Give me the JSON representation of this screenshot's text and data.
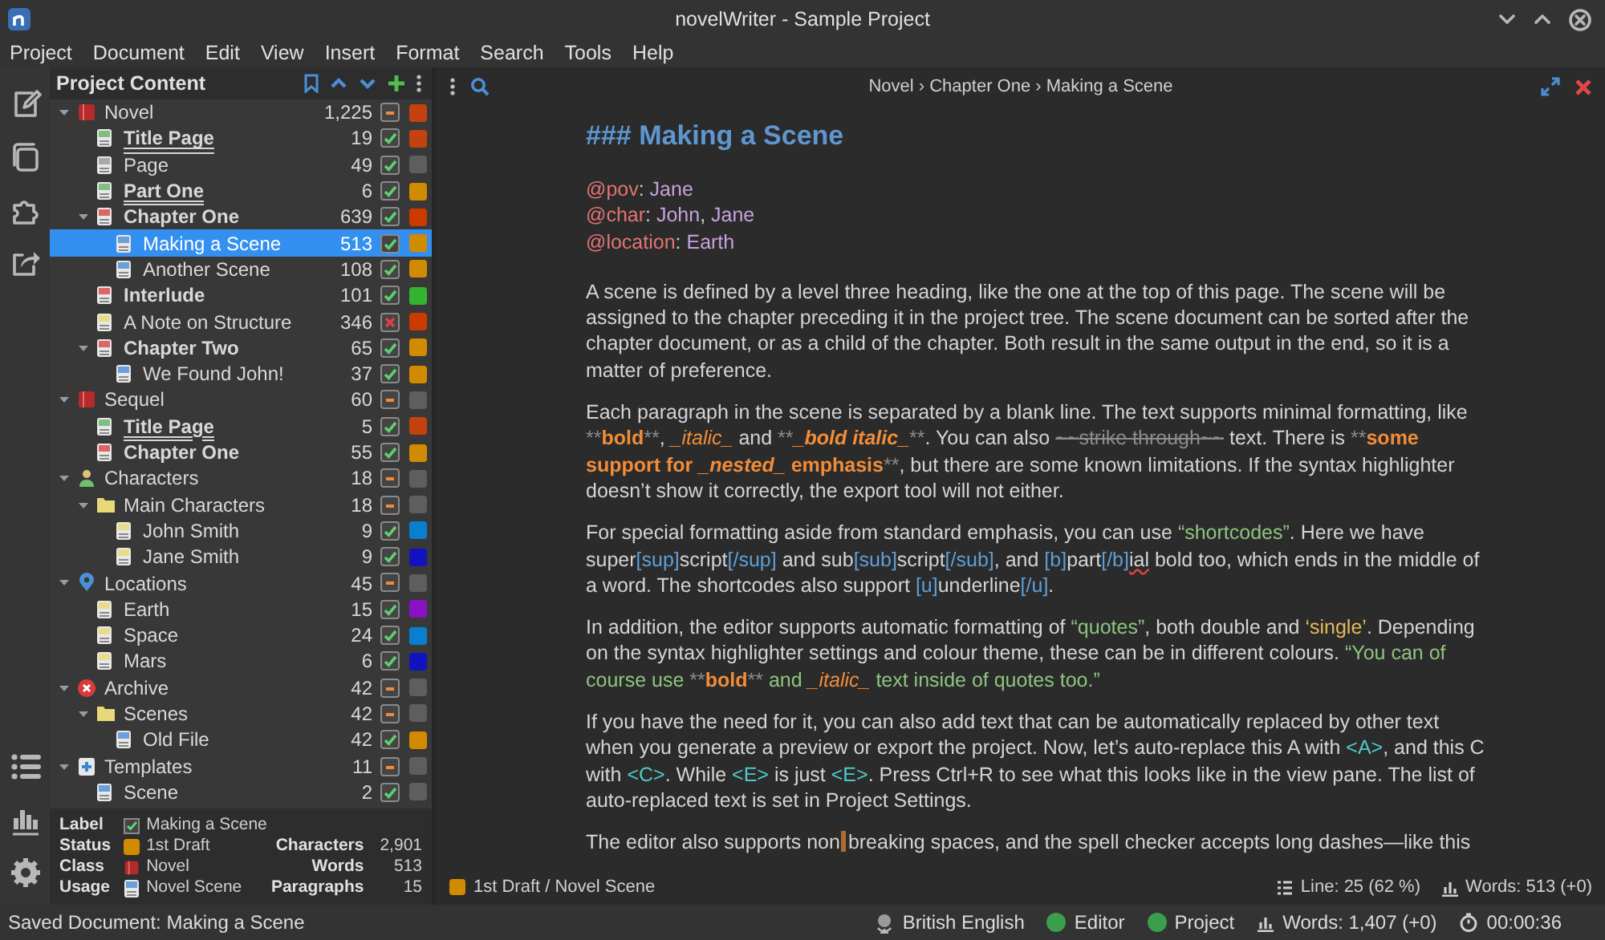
{
  "window": {
    "title": "novelWriter - Sample Project"
  },
  "menu": [
    "Project",
    "Document",
    "Edit",
    "View",
    "Insert",
    "Format",
    "Search",
    "Tools",
    "Help"
  ],
  "project_tree": {
    "title": "Project Content",
    "items": [
      {
        "label": "Novel",
        "kind": "novel",
        "words": "1,225",
        "color": "#c4420f",
        "selected": false,
        "expanded": true,
        "children": [
          {
            "label": "Title Page",
            "kind": "title",
            "words": "19",
            "active": true,
            "color": "#c4420f",
            "selected": false
          },
          {
            "label": "Page",
            "kind": "page",
            "words": "49",
            "active": true,
            "color": "#5e5e5e",
            "selected": false
          },
          {
            "label": "Part One",
            "kind": "partition",
            "words": "6",
            "active": true,
            "color": "#d18b00",
            "selected": false
          },
          {
            "label": "Chapter One",
            "kind": "chapter",
            "words": "639",
            "active": true,
            "color": "#cc3a00",
            "selected": false,
            "expanded": true,
            "children": [
              {
                "label": "Making a Scene",
                "kind": "scene",
                "words": "513",
                "active": true,
                "color": "#d18b00",
                "selected": true
              },
              {
                "label": "Another Scene",
                "kind": "scene",
                "words": "108",
                "active": true,
                "color": "#d18b00",
                "selected": false
              }
            ]
          },
          {
            "label": "Interlude",
            "kind": "chapter",
            "words": "101",
            "active": true,
            "color": "#33b533",
            "selected": false
          },
          {
            "label": "A Note on Structure",
            "kind": "note",
            "words": "346",
            "active": false,
            "color": "#cc3a00",
            "selected": false
          },
          {
            "label": "Chapter Two",
            "kind": "chapter",
            "words": "65",
            "active": true,
            "color": "#d18b00",
            "selected": false,
            "expanded": true,
            "children": [
              {
                "label": "We Found John!",
                "kind": "scene",
                "words": "37",
                "active": true,
                "color": "#d18b00",
                "selected": false
              }
            ]
          }
        ]
      },
      {
        "label": "Sequel",
        "kind": "novel",
        "words": "60",
        "color": "#5e5e5e",
        "selected": false,
        "expanded": true,
        "children": [
          {
            "label": "Title Page",
            "kind": "title",
            "words": "5",
            "active": true,
            "color": "#c4420f",
            "selected": false
          },
          {
            "label": "Chapter One",
            "kind": "chapter",
            "words": "55",
            "active": true,
            "color": "#d18b00",
            "selected": false
          }
        ]
      },
      {
        "label": "Characters",
        "kind": "characters",
        "words": "18",
        "color": "#5e5e5e",
        "selected": false,
        "expanded": true,
        "children": [
          {
            "label": "Main Characters",
            "kind": "folder",
            "words": "18",
            "color": "#5e5e5e",
            "selected": false,
            "expanded": true,
            "children": [
              {
                "label": "John Smith",
                "kind": "note",
                "words": "9",
                "active": true,
                "color": "#0a7fd0",
                "selected": false
              },
              {
                "label": "Jane Smith",
                "kind": "note",
                "words": "9",
                "active": true,
                "color": "#1212c0",
                "selected": false
              }
            ]
          }
        ]
      },
      {
        "label": "Locations",
        "kind": "locations",
        "words": "45",
        "color": "#5e5e5e",
        "selected": false,
        "expanded": true,
        "children": [
          {
            "label": "Earth",
            "kind": "note",
            "words": "15",
            "active": true,
            "color": "#8a10c4",
            "selected": false
          },
          {
            "label": "Space",
            "kind": "note",
            "words": "24",
            "active": true,
            "color": "#0a7fd0",
            "selected": false
          },
          {
            "label": "Mars",
            "kind": "note",
            "words": "6",
            "active": true,
            "color": "#1212c0",
            "selected": false
          }
        ]
      },
      {
        "label": "Archive",
        "kind": "archive",
        "words": "42",
        "color": "#5e5e5e",
        "selected": false,
        "expanded": true,
        "children": [
          {
            "label": "Scenes",
            "kind": "folder",
            "words": "42",
            "color": "#5e5e5e",
            "selected": false,
            "expanded": true,
            "children": [
              {
                "label": "Old File",
                "kind": "scene",
                "words": "42",
                "active": true,
                "color": "#d18b00",
                "selected": false
              }
            ]
          }
        ]
      },
      {
        "label": "Templates",
        "kind": "templates",
        "words": "11",
        "color": "#5e5e5e",
        "selected": false,
        "expanded": true,
        "children": [
          {
            "label": "Scene",
            "kind": "scene",
            "words": "2",
            "active": true,
            "color": "#5e5e5e",
            "selected": false
          }
        ]
      }
    ]
  },
  "details": {
    "rows": [
      {
        "key": "Label",
        "kind": "check",
        "value": "Making a Scene"
      },
      {
        "key": "Status",
        "kind": "status",
        "value": "1st Draft",
        "color": "#d18b00"
      },
      {
        "key": "Class",
        "kind": "class",
        "value": "Novel"
      },
      {
        "key": "Usage",
        "kind": "usage",
        "value": "Novel Scene"
      }
    ],
    "stats": [
      {
        "label": "Characters",
        "value": "2,901"
      },
      {
        "label": "Words",
        "value": "513"
      },
      {
        "label": "Paragraphs",
        "value": "15"
      }
    ]
  },
  "editor": {
    "breadcrumb": "Novel › Chapter One › Making a Scene",
    "blocks": [
      {
        "kind": "heading",
        "text": "### Making a Scene"
      },
      {
        "kind": "meta",
        "lines": [
          [
            {
              "kind": "keyword",
              "text": "@pov"
            },
            {
              "kind": "plain",
              "text": ": "
            },
            {
              "kind": "value",
              "text": "Jane"
            }
          ],
          [
            {
              "kind": "keyword",
              "text": "@char"
            },
            {
              "kind": "plain",
              "text": ": "
            },
            {
              "kind": "value",
              "text": "John"
            },
            {
              "kind": "plain",
              "text": ", "
            },
            {
              "kind": "value",
              "text": "Jane"
            }
          ],
          [
            {
              "kind": "keyword",
              "text": "@location"
            },
            {
              "kind": "plain",
              "text": ": "
            },
            {
              "kind": "value",
              "text": "Earth"
            }
          ]
        ]
      },
      {
        "kind": "paragraph",
        "segments": [
          {
            "kind": "plain",
            "text": "A scene is defined by a level three heading, like the one at the top of this page. The scene will be assigned to the chapter preceding it in the project tree. The scene document can be sorted after the chapter document, or as a child of the chapter. Both result in the same output in the end, so it is a matter of preference."
          }
        ]
      },
      {
        "kind": "paragraph",
        "segments": [
          {
            "kind": "plain",
            "text": "Each paragraph in the scene is separated by a blank line. The text supports minimal formatting, like "
          },
          {
            "kind": "markup",
            "text": "**"
          },
          {
            "kind": "bold",
            "text": "bold"
          },
          {
            "kind": "markup",
            "text": "**"
          },
          {
            "kind": "plain",
            "text": ", "
          },
          {
            "kind": "italic",
            "text": "_italic_"
          },
          {
            "kind": "plain",
            "text": " and "
          },
          {
            "kind": "markup",
            "text": "**"
          },
          {
            "kind": "bolditalic",
            "text": "_bold italic_"
          },
          {
            "kind": "markup",
            "text": "**"
          },
          {
            "kind": "plain",
            "text": ". You can also "
          },
          {
            "kind": "strike",
            "text": "~~strike through~~"
          },
          {
            "kind": "plain",
            "text": " text. There is "
          },
          {
            "kind": "markup",
            "text": "**"
          },
          {
            "kind": "bold",
            "text": "some support for "
          },
          {
            "kind": "bolditalic",
            "text": "_nested_"
          },
          {
            "kind": "bold",
            "text": " emphasis"
          },
          {
            "kind": "markup",
            "text": "**"
          },
          {
            "kind": "plain",
            "text": ", but there are some known limitations. If the syntax highlighter doesn’t show it correctly, the export tool will not either."
          }
        ]
      },
      {
        "kind": "paragraph",
        "segments": [
          {
            "kind": "plain",
            "text": "For special formatting aside from standard emphasis, you can use "
          },
          {
            "kind": "quote",
            "text": "“shortcodes”"
          },
          {
            "kind": "plain",
            "text": ". Here we have super"
          },
          {
            "kind": "code",
            "text": "[sup]"
          },
          {
            "kind": "plain",
            "text": "script"
          },
          {
            "kind": "code",
            "text": "[/sup]"
          },
          {
            "kind": "plain",
            "text": " and sub"
          },
          {
            "kind": "code",
            "text": "[sub]"
          },
          {
            "kind": "plain",
            "text": "script"
          },
          {
            "kind": "code",
            "text": "[/sub]"
          },
          {
            "kind": "plain",
            "text": ", and "
          },
          {
            "kind": "code",
            "text": "[b]"
          },
          {
            "kind": "plain",
            "text": "part"
          },
          {
            "kind": "code",
            "text": "[/b]"
          },
          {
            "kind": "misspelled",
            "text": "ial"
          },
          {
            "kind": "plain",
            "text": " bold too, which ends in the middle of a word. The shortcodes also support "
          },
          {
            "kind": "code",
            "text": "[u]"
          },
          {
            "kind": "plain",
            "text": "underline"
          },
          {
            "kind": "code",
            "text": "[/u]"
          },
          {
            "kind": "plain",
            "text": "."
          }
        ]
      },
      {
        "kind": "paragraph",
        "segments": [
          {
            "kind": "plain",
            "text": "In addition, the editor supports automatic formatting of "
          },
          {
            "kind": "quote",
            "text": "“quotes”"
          },
          {
            "kind": "plain",
            "text": ", both double and "
          },
          {
            "kind": "single",
            "text": "‘single’"
          },
          {
            "kind": "plain",
            "text": ". Depending on the syntax highlighter settings and colour theme, these can be in different colours. "
          },
          {
            "kind": "quote",
            "text": "“You can of course use "
          },
          {
            "kind": "markup",
            "text": "**"
          },
          {
            "kind": "bold",
            "text": "bold"
          },
          {
            "kind": "markup",
            "text": "**"
          },
          {
            "kind": "quote",
            "text": " and "
          },
          {
            "kind": "italic",
            "text": "_italic_"
          },
          {
            "kind": "quote",
            "text": " text inside of quotes too.”"
          }
        ]
      },
      {
        "kind": "paragraph",
        "segments": [
          {
            "kind": "plain",
            "text": "If you have the need for it, you can also add text that can be automatically replaced by other text when you generate a preview or export the project. Now, let’s auto-replace this A with "
          },
          {
            "kind": "replace",
            "text": "<A>"
          },
          {
            "kind": "plain",
            "text": ", and this C with "
          },
          {
            "kind": "replace",
            "text": "<C>"
          },
          {
            "kind": "plain",
            "text": ". While "
          },
          {
            "kind": "replace",
            "text": "<E>"
          },
          {
            "kind": "plain",
            "text": " is just "
          },
          {
            "kind": "replace",
            "text": "<E>"
          },
          {
            "kind": "plain",
            "text": ". Press Ctrl+R to see what this looks like in the view pane. The list of auto-replaced text is set in Project Settings."
          }
        ]
      },
      {
        "kind": "paragraph",
        "segments": [
          {
            "kind": "plain",
            "text": "The editor also supports non"
          },
          {
            "kind": "nbsp"
          },
          {
            "kind": "plain",
            "text": "breaking spaces, and the spell checker accepts long dashes—like this"
          }
        ]
      }
    ],
    "footer": {
      "status": {
        "text": "1st Draft / Novel Scene",
        "color": "#d18b00"
      },
      "items": [
        {
          "kind": "lines",
          "text": "Line: 25 (62 %)"
        },
        {
          "kind": "words",
          "text": "Words: 513 (+0)"
        }
      ]
    }
  },
  "status_bar": {
    "message": "Saved Document: Making a Scene",
    "items": [
      {
        "kind": "language",
        "text": "British English"
      },
      {
        "kind": "dot",
        "color": "#3a9f4a",
        "text": "Editor"
      },
      {
        "kind": "dot",
        "color": "#3a9f4a",
        "text": "Project"
      },
      {
        "kind": "words",
        "text": "Words: 1,407 (+0)"
      },
      {
        "kind": "timer",
        "text": "00:00:36"
      }
    ]
  }
}
